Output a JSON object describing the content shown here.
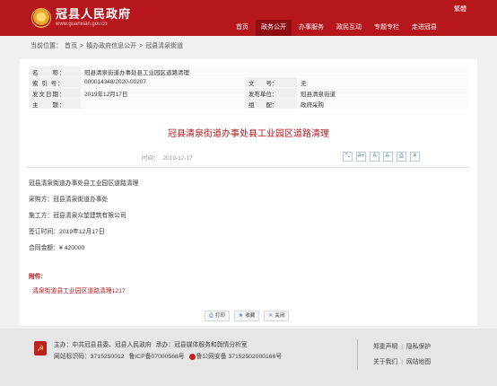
{
  "header": {
    "site_title": "冠县人民政府",
    "site_url": "www.guanxian.gov.cn",
    "traditional": "繁體",
    "nav": [
      "首页",
      "政务公开",
      "办事服务",
      "政民互动",
      "专题专栏",
      "走进冠县"
    ],
    "active_nav": "政务公开"
  },
  "breadcrumb": {
    "prefix": "当前位置：",
    "items": [
      "首页",
      ">",
      "镇办政府信息公开",
      ">",
      "冠县清泉街道"
    ]
  },
  "meta": {
    "name_label": "名　　称：",
    "name_value": "冠县清泉街道办事处县工业园区道路清理",
    "index_label": "索 引 号：",
    "index_value": "000014348/2020-00207",
    "doc_no_label": "文　　号：",
    "doc_no_value": "无",
    "date_label": "发文日期：",
    "date_value": "2019年12月17日",
    "unit_label": "发布单位：",
    "unit_value": "冠县清泉街道",
    "topic_label": "主　　题：",
    "topic_value": "",
    "category_label": "组　　配：",
    "category_value": "政府采购"
  },
  "article": {
    "title": "冠县清泉街道办事处县工业园区道路清理",
    "time_label": "时间：",
    "time_value": "2019-12-17",
    "tools": [
      "⤡",
      "A+",
      "A",
      "A-",
      "⎙",
      "✕"
    ],
    "lines": [
      "冠县清泉街道办事处县工业园区道路清理",
      "采购方：冠县清泉街道办事处",
      "施工方：冠县清泉众望建筑有限公司",
      "签订时间：2019年12月17日",
      "合同金额：¥ 420000"
    ],
    "attachment_title": "附件:",
    "attachment_link": "· 清泉街道县工业园区道路清理1217"
  },
  "buttons": [
    {
      "icon": "⎙",
      "label": "打印"
    },
    {
      "icon": "★",
      "label": "收藏"
    },
    {
      "icon": "✕",
      "label": "关闭"
    }
  ],
  "footer": {
    "sponsor": "主办：中共冠县县委、冠县人民政府",
    "organizer": "承办：冠县媒体服务和舆情分析室",
    "site_id": "网站标识码：3715250012",
    "icp": "鲁ICP备07000568号",
    "police": "鲁公网安备 37152502000166号",
    "links_row1": [
      "郑重声明",
      "隐私保护"
    ],
    "links_row2": [
      "关于我们",
      "网站地图"
    ]
  }
}
